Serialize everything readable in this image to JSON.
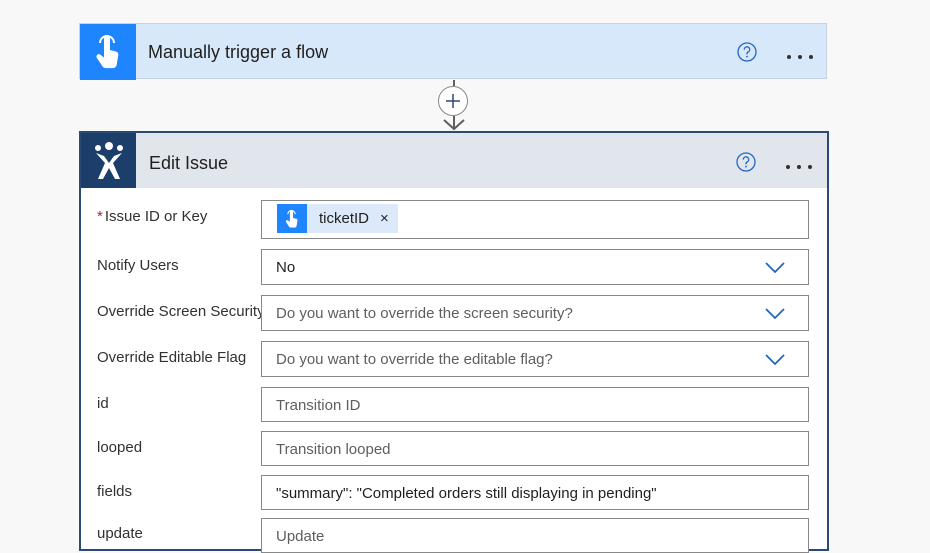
{
  "trigger": {
    "title": "Manually trigger a flow",
    "icon": "touch-icon",
    "accent": "#1f85ff"
  },
  "connector": {
    "add_icon": "plus-icon"
  },
  "action": {
    "title": "Edit Issue",
    "icon": "jira-icon",
    "accent": "#1b3e6b",
    "fields": {
      "issue_id": {
        "label": "Issue ID or Key",
        "required_mark": "*",
        "token": {
          "label": "ticketID",
          "remove": "×",
          "icon": "touch-icon"
        }
      },
      "notify_users": {
        "label": "Notify Users",
        "value": "No"
      },
      "override_screen_security": {
        "label": "Override Screen Security",
        "placeholder": "Do you want to override the screen security?"
      },
      "override_editable_flag": {
        "label": "Override Editable Flag",
        "placeholder": "Do you want to override the editable flag?"
      },
      "id": {
        "label": "id",
        "placeholder": "Transition ID"
      },
      "looped": {
        "label": "looped",
        "placeholder": "Transition looped"
      },
      "fields": {
        "label": "fields",
        "value": "\"summary\": \"Completed orders still displaying in pending\""
      },
      "update": {
        "label": "update",
        "placeholder": "Update"
      }
    }
  }
}
